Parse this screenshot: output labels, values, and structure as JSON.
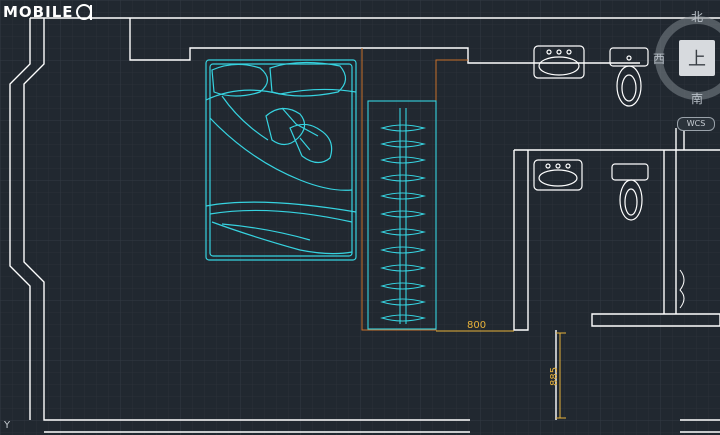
{
  "logo": {
    "text": "MOBILE"
  },
  "viewcube": {
    "north": "北",
    "south": "南",
    "west": "西",
    "top_face": "上",
    "coord_system": "WCS"
  },
  "dimensions": [
    {
      "id": "width",
      "value": "800"
    },
    {
      "id": "height",
      "value": "885"
    }
  ],
  "ucs": {
    "axis_y": "Y"
  },
  "colors": {
    "background": "#212830",
    "walls": "#ffffff",
    "furniture": "#36d3e0",
    "dimension": "#e8b23a",
    "outline_orange": "#c8702a"
  }
}
